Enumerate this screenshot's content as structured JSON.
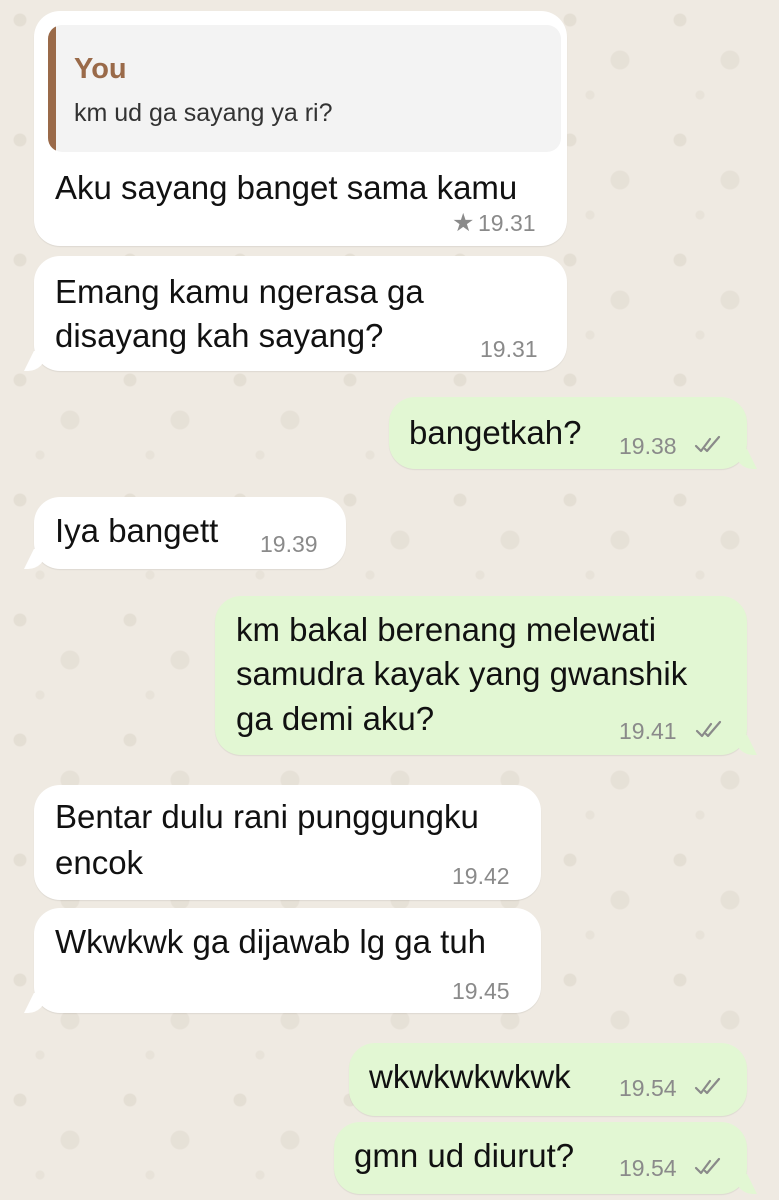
{
  "colors": {
    "background": "#efeae2",
    "incoming_bubble": "#ffffff",
    "outgoing_bubble": "#e2f7d3",
    "quote_accent": "#9a6a49",
    "timestamp": "#8a8a8a"
  },
  "messages": [
    {
      "direction": "incoming",
      "reply_to": {
        "author": "You",
        "text": "km ud ga sayang ya ri?"
      },
      "lines": [
        "Aku sayang banget sama kamu"
      ],
      "time": "19.31",
      "starred": true,
      "star_icon": "★"
    },
    {
      "direction": "incoming",
      "lines": [
        "Emang kamu ngerasa ga",
        "disayang kah sayang?"
      ],
      "time": "19.31"
    },
    {
      "direction": "outgoing",
      "lines": [
        "bangetkah?"
      ],
      "time": "19.38",
      "status": "read"
    },
    {
      "direction": "incoming",
      "lines": [
        "Iya bangett"
      ],
      "time": "19.39"
    },
    {
      "direction": "outgoing",
      "lines": [
        "km bakal berenang melewati",
        "samudra kayak yang gwanshik",
        "ga demi aku?"
      ],
      "time": "19.41",
      "status": "read"
    },
    {
      "direction": "incoming",
      "lines": [
        "Bentar dulu rani punggungku",
        "encok"
      ],
      "time": "19.42"
    },
    {
      "direction": "incoming",
      "lines": [
        "Wkwkwk ga dijawab lg ga tuh"
      ],
      "time": "19.45"
    },
    {
      "direction": "outgoing",
      "lines": [
        "wkwkwkwkwk"
      ],
      "time": "19.54",
      "status": "read"
    },
    {
      "direction": "outgoing",
      "lines": [
        "gmn ud diurut?"
      ],
      "time": "19.54",
      "status": "read"
    }
  ]
}
